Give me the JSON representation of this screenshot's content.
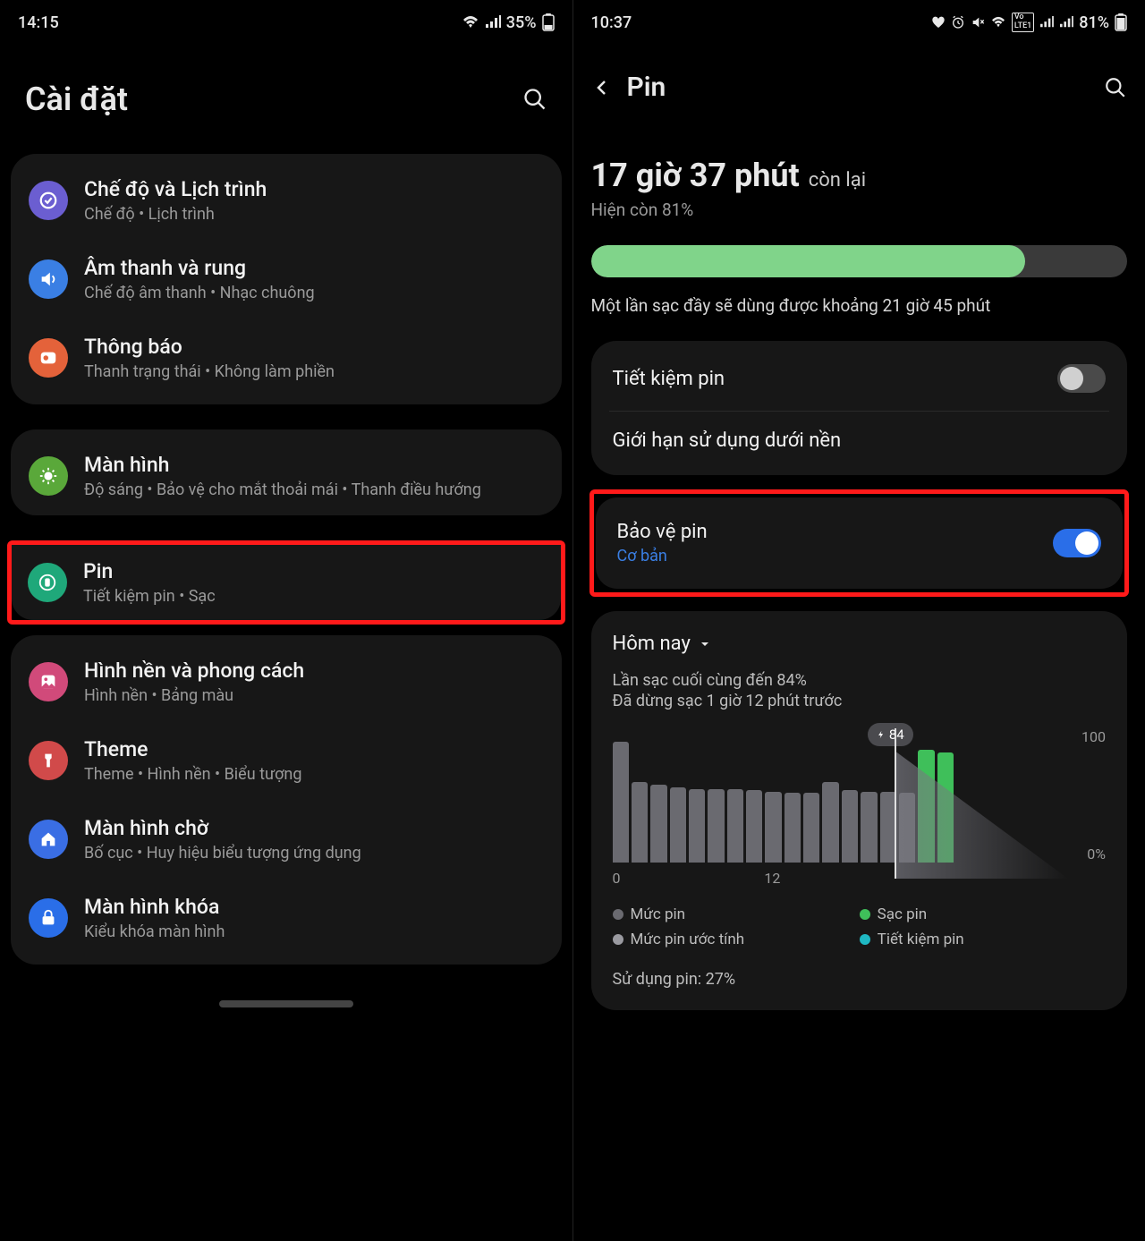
{
  "left": {
    "status": {
      "time": "14:15",
      "battery": "35%"
    },
    "title": "Cài đặt",
    "groups": [
      [
        {
          "label": "Chế độ và Lịch trình",
          "sub": "Chế độ  •  Lịch trình",
          "icon": "mode-icon",
          "color": "ic-purple"
        },
        {
          "label": "Âm thanh và rung",
          "sub": "Chế độ âm thanh  •  Nhạc chuông",
          "icon": "sound-icon",
          "color": "ic-blue"
        },
        {
          "label": "Thông báo",
          "sub": "Thanh trạng thái  •  Không làm phiền",
          "icon": "notification-icon",
          "color": "ic-orange"
        }
      ],
      [
        {
          "label": "Màn hình",
          "sub": "Độ sáng  •  Bảo vệ cho mắt thoải mái  •  Thanh điều hướng",
          "icon": "display-icon",
          "color": "ic-green"
        },
        {
          "label": "Pin",
          "sub": "Tiết kiệm pin  •  Sạc",
          "icon": "battery-icon",
          "color": "ic-teal",
          "highlight": true
        }
      ],
      [
        {
          "label": "Hình nền và phong cách",
          "sub": "Hình nền  •  Bảng màu",
          "icon": "wallpaper-icon",
          "color": "ic-pink"
        },
        {
          "label": "Theme",
          "sub": "Theme  •  Hình nền  •  Biểu tượng",
          "icon": "theme-icon",
          "color": "ic-red"
        },
        {
          "label": "Màn hình chờ",
          "sub": "Bố cục  •  Huy hiệu biểu tượng ứng dụng",
          "icon": "home-icon",
          "color": "ic-blue2"
        },
        {
          "label": "Màn hình khóa",
          "sub": "Kiểu khóa màn hình",
          "icon": "lock-icon",
          "color": "ic-blue3"
        }
      ]
    ]
  },
  "right": {
    "status": {
      "time": "10:37",
      "battery": "81%"
    },
    "title": "Pin",
    "remaining_big": "17 giờ 37 phút",
    "remaining_small": "còn lại",
    "current_pct_line": "Hiện còn 81%",
    "fullcharge_line": "Một lần sạc đầy sẽ dùng được khoảng 21 giờ 45 phút",
    "rows": {
      "powersave": "Tiết kiệm pin",
      "bg_limit": "Giới hạn sử dụng dưới nền",
      "protect": "Bảo vệ pin",
      "protect_sub": "Cơ bản"
    },
    "today": "Hôm nay",
    "lastcharge": "Lần sạc cuối cùng đến 84%",
    "lastcharge2": "Đã dừng sạc 1 giờ 12 phút trước",
    "badge": "84",
    "axis": {
      "x0": "0",
      "x12": "12",
      "y100": "100",
      "y0": "0%"
    },
    "legend": {
      "level": "Mức pin",
      "charging": "Sạc pin",
      "estimate": "Mức pin ước tính",
      "saver": "Tiết kiệm pin"
    },
    "usage_line": "Sử dụng pin: 27%"
  },
  "chart_data": {
    "type": "bar",
    "title": "Hôm nay",
    "xlabel": "",
    "ylabel": "",
    "ylim": [
      0,
      100
    ],
    "badge_value": 84,
    "x_ticks": [
      0,
      12
    ],
    "hours": [
      0,
      1,
      2,
      3,
      4,
      5,
      6,
      7,
      8,
      9,
      10,
      11,
      12,
      13,
      14,
      15,
      16,
      17,
      18,
      19,
      20,
      21,
      22,
      23
    ],
    "series": [
      {
        "name": "Mức pin",
        "color": "#6a6a70",
        "values": [
          90,
          60,
          58,
          56,
          55,
          55,
          55,
          54,
          53,
          52,
          52,
          60,
          54,
          53,
          53,
          52,
          null,
          null,
          null,
          null,
          null,
          null,
          null,
          null
        ]
      },
      {
        "name": "Sạc pin",
        "color": "#3fbf5a",
        "values": [
          null,
          null,
          null,
          null,
          null,
          null,
          null,
          null,
          null,
          null,
          null,
          null,
          null,
          null,
          null,
          null,
          84,
          82,
          null,
          null,
          null,
          null,
          null,
          null
        ]
      },
      {
        "name": "Mức pin ước tính",
        "color": "#9a9aa0",
        "values": [
          null,
          null,
          null,
          null,
          null,
          null,
          null,
          null,
          null,
          null,
          null,
          null,
          null,
          null,
          null,
          null,
          null,
          null,
          65,
          55,
          45,
          35,
          22,
          8
        ]
      },
      {
        "name": "Tiết kiệm pin",
        "color": "#1fb8c3",
        "values": []
      }
    ]
  }
}
